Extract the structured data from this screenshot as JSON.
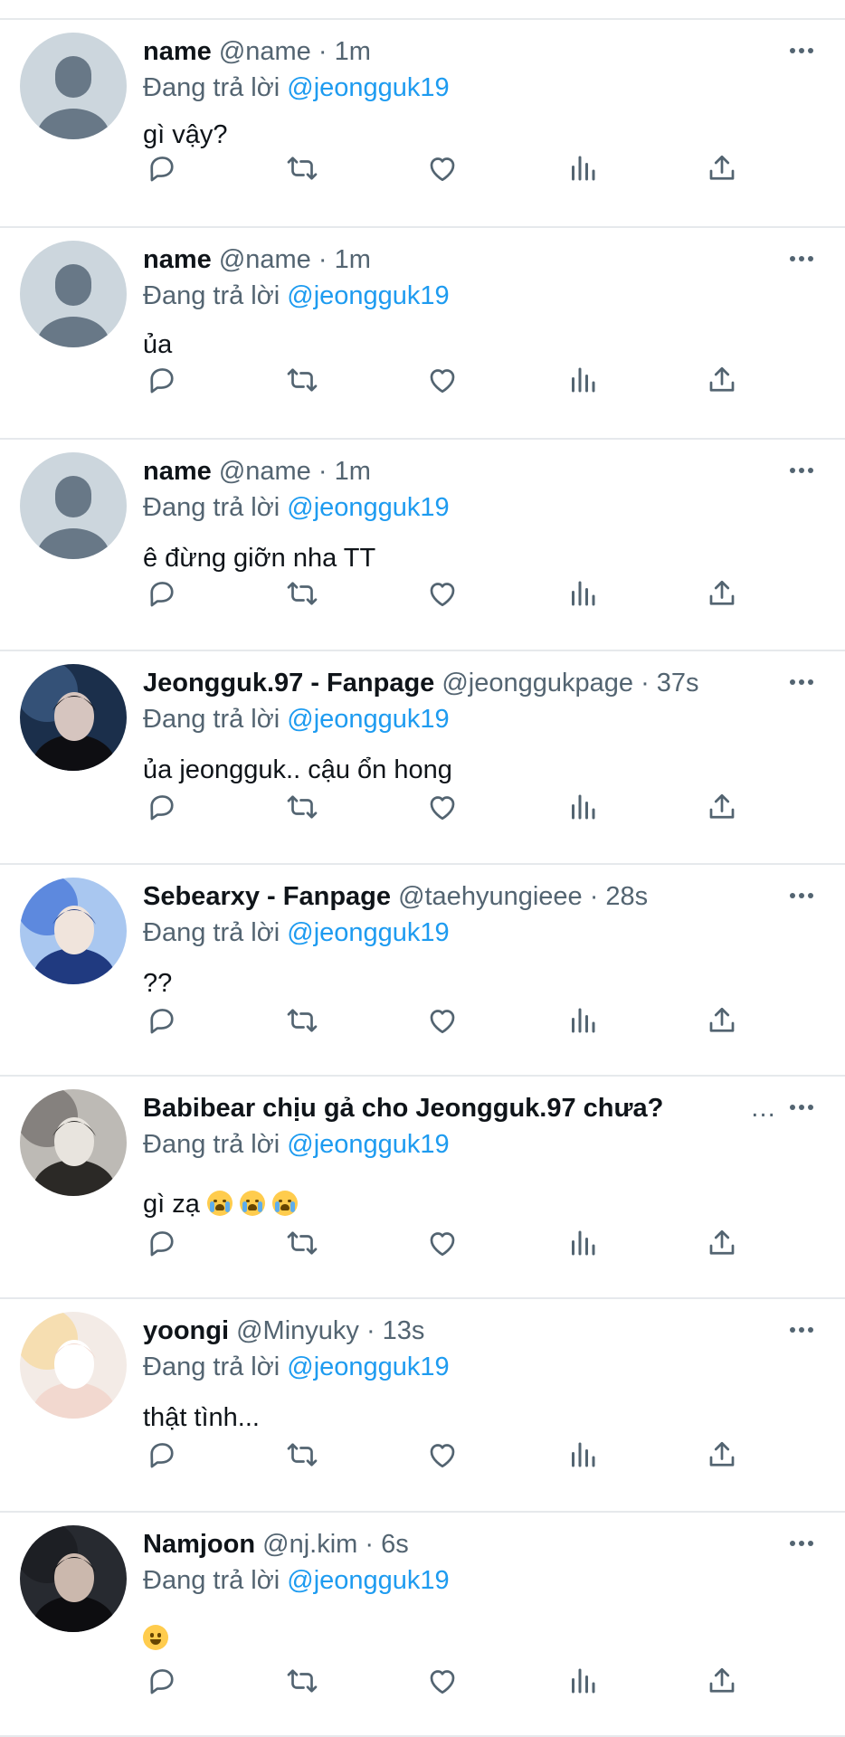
{
  "feed": {
    "replying_label": "Đang trả lời",
    "reply_target": "@jeongguk19",
    "ellipsis": "…",
    "tweets": [
      {
        "name": "name",
        "meta": "@name · 1m",
        "text": "gì vậy?"
      },
      {
        "name": "name",
        "meta": "@name · 1m",
        "text": "ủa"
      },
      {
        "name": "name",
        "meta": "@name · 1m",
        "text": "ê đừng giỡn nha TT"
      },
      {
        "name": "Jeongguk.97 - Fanpage",
        "meta": "@jeonggukpage · 37s",
        "text": "ủa jeongguk.. cậu ổn hong"
      },
      {
        "name": "Sebearxy - Fanpage",
        "meta": "@taehyungieee · 28s",
        "text": "??"
      },
      {
        "name": "Babibear chịu gả cho Jeongguk.97 chưa?",
        "meta": "",
        "text": "gì zạ",
        "emoji": [
          "loudly-crying-face",
          "loudly-crying-face",
          "loudly-crying-face"
        ]
      },
      {
        "name": "yoongi",
        "meta": "@Minyuky · 13s",
        "text": "thật tình..."
      },
      {
        "name": "Namjoon",
        "meta": "@nj.kim · 6s",
        "text": "",
        "emoji": [
          "grinning-face"
        ]
      }
    ]
  },
  "colors": {
    "link": "#1d9bf0",
    "secondary": "#536471",
    "separator": "#e6e9ec"
  }
}
